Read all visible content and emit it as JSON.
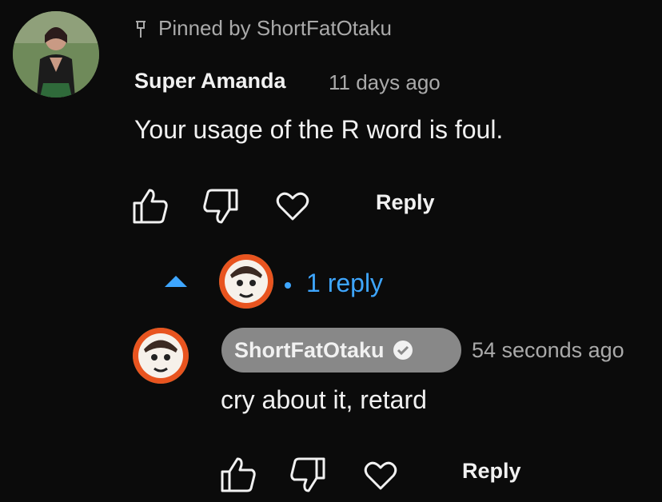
{
  "pinned": {
    "label": "Pinned by ShortFatOtaku",
    "icon": "pin-icon"
  },
  "comment": {
    "author": "Super Amanda",
    "time": "11 days ago",
    "text": "Your usage of the R word is foul.",
    "actions": {
      "like_icon": "thumbs-up-icon",
      "dislike_icon": "thumbs-down-icon",
      "heart_icon": "heart-icon",
      "reply_label": "Reply"
    }
  },
  "replies_toggle": {
    "label": "1 reply",
    "icon": "caret-up-icon",
    "accent_color": "#3ea6ff"
  },
  "reply": {
    "author": "ShortFatOtaku",
    "verified_icon": "verified-check-icon",
    "time": "54 seconds ago",
    "text": "cry about it, retard",
    "actions": {
      "like_icon": "thumbs-up-icon",
      "dislike_icon": "thumbs-down-icon",
      "heart_icon": "heart-icon",
      "reply_label": "Reply"
    }
  },
  "colors": {
    "background": "#0b0b0b",
    "text": "#f1f1f1",
    "secondary_text": "#aaaaaa",
    "owner_chip": "#888888",
    "link": "#3ea6ff"
  }
}
